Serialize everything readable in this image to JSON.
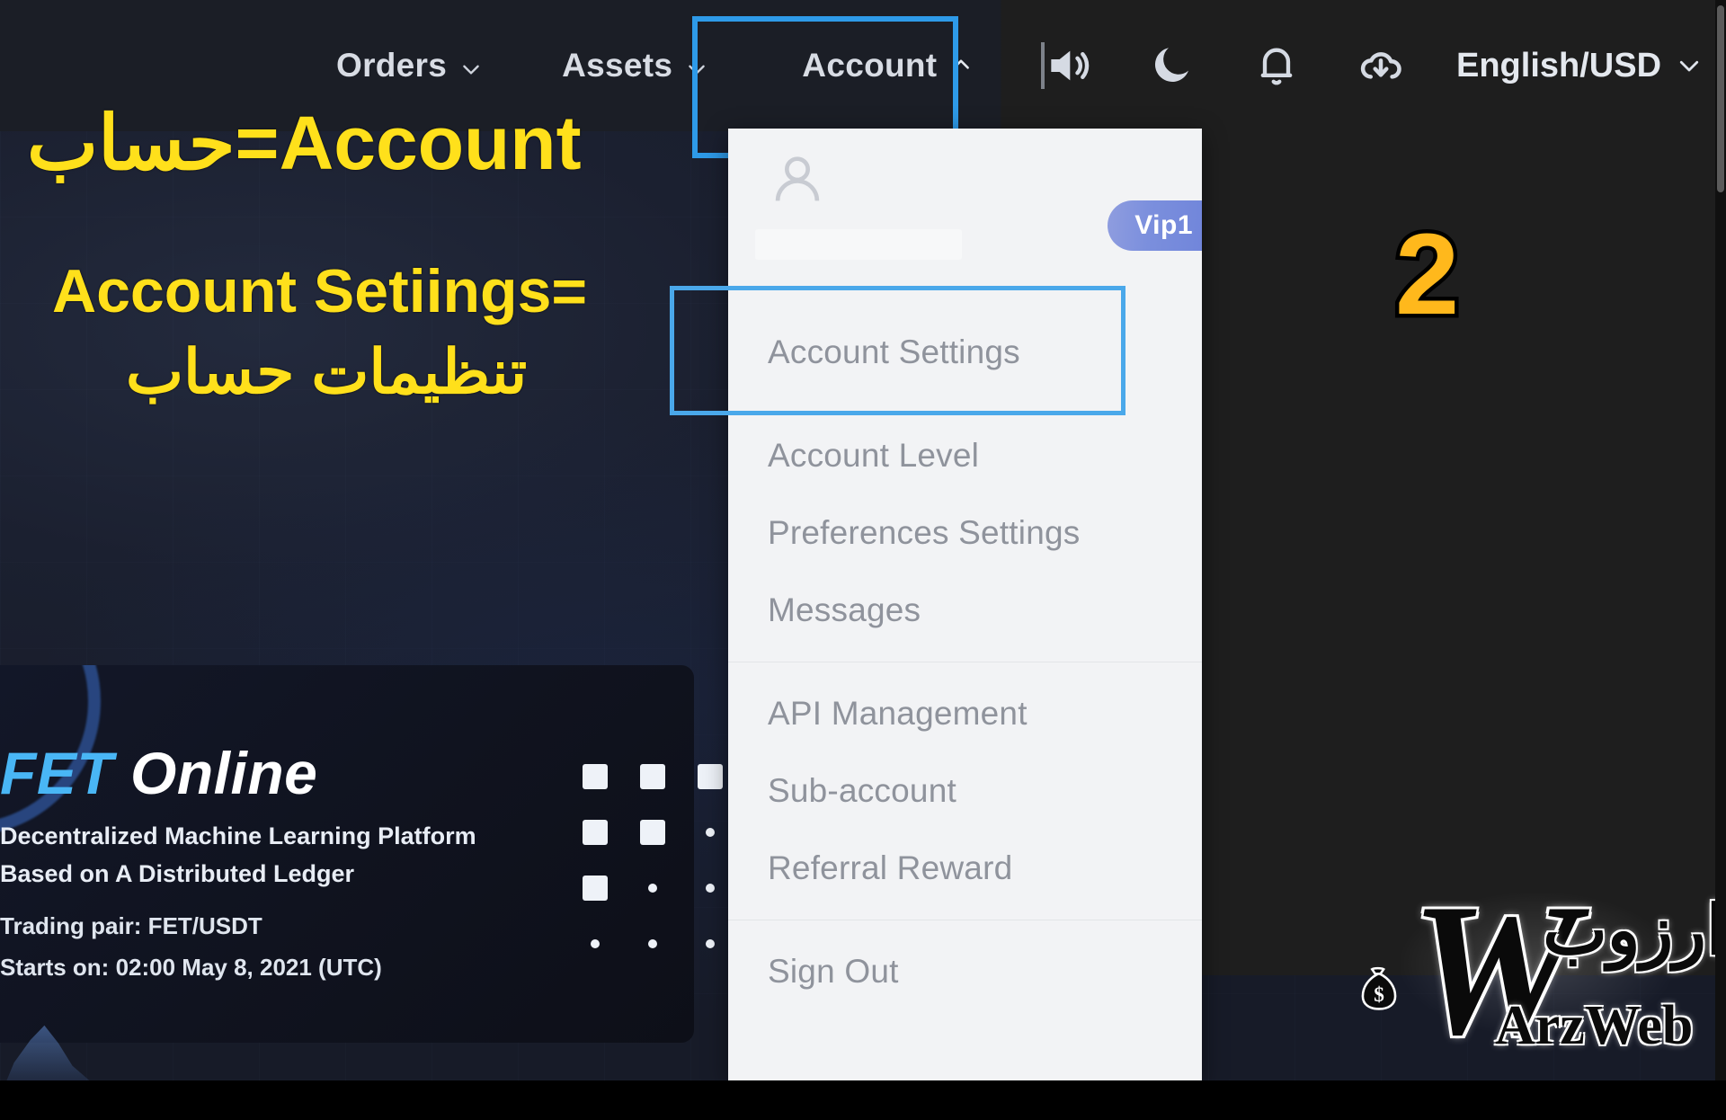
{
  "navbar": {
    "items": [
      {
        "label": "Orders",
        "icon": "chevron-down-icon"
      },
      {
        "label": "Assets",
        "icon": "chevron-down-icon"
      },
      {
        "label": "Account",
        "icon": "chevron-up-icon"
      }
    ],
    "icons": [
      {
        "name": "speaker-icon"
      },
      {
        "name": "moon-icon"
      },
      {
        "name": "bell-icon"
      },
      {
        "name": "download-cloud-icon"
      }
    ],
    "language": {
      "label": "English/USD",
      "icon": "chevron-down-icon"
    }
  },
  "dropdown": {
    "vip_badge": "Vip1",
    "items": [
      {
        "label": "Account Settings",
        "selected": true
      },
      {
        "label": "Account Level",
        "selected": false
      },
      {
        "label": "Preferences Settings",
        "selected": false
      },
      {
        "label": "Messages",
        "selected": false
      },
      {
        "label": "API Management",
        "selected": false
      },
      {
        "label": "Sub-account",
        "selected": false
      },
      {
        "label": "Referral Reward",
        "selected": false
      },
      {
        "label": "Sign Out",
        "selected": false
      }
    ]
  },
  "annotations": {
    "line1": "Account=حساب",
    "line2": "Account Setiings=",
    "line3": "تنظیمات حساب",
    "step_number": "2"
  },
  "promo": {
    "brand": "FET",
    "title_rest": " Online",
    "subtitle_line1": "Decentralized Machine Learning Platform",
    "subtitle_line2": "Based on A Distributed Ledger",
    "trading_pair": "Trading pair: FET/USDT",
    "starts_on": "Starts on: 02:00 May 8, 2021 (UTC)"
  },
  "watermark": {
    "letter": "W",
    "arabic": "ارزوب",
    "latin": "ArzWeb"
  },
  "colors": {
    "accent_blue": "#2e9ae8",
    "annotation_yellow": "#ffe01b",
    "badge_amber": "#ffb81c",
    "vip_purple": "#7b8fdd",
    "fet_blue": "#49b6f5"
  }
}
